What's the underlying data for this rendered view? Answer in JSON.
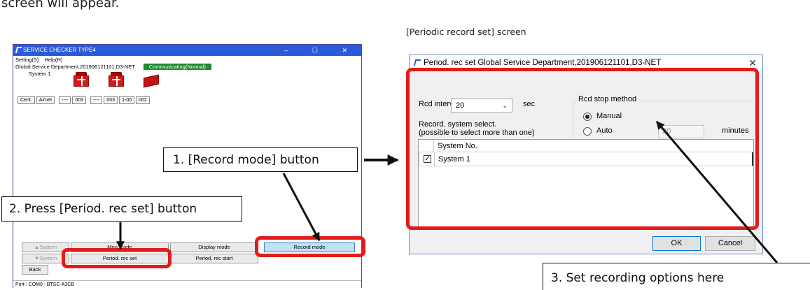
{
  "intro_text": "screen will appear.",
  "caption": "[Periodic record set] screen",
  "main_window": {
    "title": "SERVICE CHECKER TYPE4",
    "controls": "–  ☐  ✕",
    "menu": [
      "Setting(S)",
      "Help(H)"
    ],
    "department": "Global Service Department,201906121101,D3-NET",
    "comm_status": "Communicating(Normal)",
    "system_label": "System 1",
    "addresses": [
      "Cent.",
      "Airnet",
      "----",
      "003",
      "----",
      "003",
      "1-00",
      "002"
    ],
    "buttons": {
      "up_system": "▲System",
      "down_system": "▼System",
      "monitor_mode": "Mon mode",
      "display_mode": "Display mode",
      "record_mode": "Record mode",
      "period_rec_set": "Period. rec set",
      "period_rec_start": "Period. rec start",
      "back": "Back"
    },
    "port_status": "Port : COM9 : BTSC-A3CB"
  },
  "dialog": {
    "title": "Period. rec set Global Service Department,201906121101,D3-NET",
    "rcd_interval_label": "Rcd interval",
    "rcd_interval_value": "20",
    "sec_label": "sec",
    "stop_method_title": "Rcd stop method",
    "manual_label": "Manual",
    "auto_label": "Auto",
    "auto_minutes_value": "30",
    "minutes_label": "minutes",
    "select_label_1": "Record. system select.",
    "select_label_2": "(possible to select more than one)",
    "grid_header": "System No.",
    "grid_rows": [
      {
        "checked": true,
        "check_mark": "✓",
        "system": "System 1"
      }
    ],
    "ok_label": "OK",
    "cancel_label": "Cancel"
  },
  "callouts": {
    "record_mode": "1. [Record mode] button",
    "press_period": "2. Press [Period. rec set] button",
    "set_options": "3. Set recording options here"
  },
  "colors": {
    "highlight_red": "#e31b1b",
    "title_blue": "#2b5bd8",
    "comm_green": "#1f8a2e"
  }
}
